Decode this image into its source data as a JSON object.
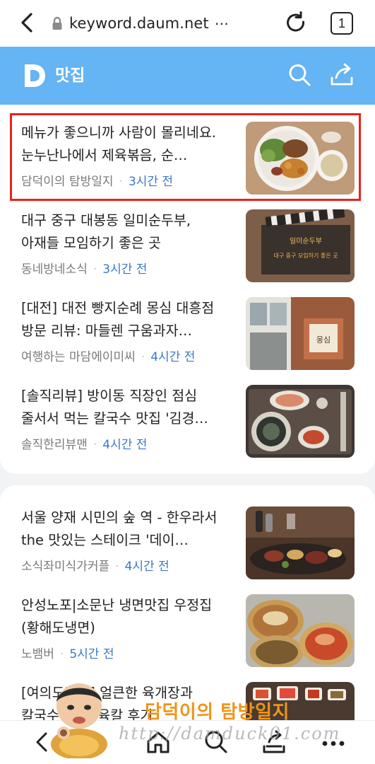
{
  "browser": {
    "url": "keyword.daum.net",
    "url_more": "⋯",
    "tab_count": "1",
    "icons": [
      "back-arrow",
      "lock",
      "reload",
      "tab-switcher"
    ]
  },
  "header": {
    "logo": "D",
    "title": "맛집",
    "accent_color": "#65b4f3",
    "icons": [
      "search",
      "share"
    ]
  },
  "results": [
    {
      "title": "메뉴가 좋으니까 사람이 몰리네요. 눈누난나에서 제육볶음, 순…",
      "source": "담덕이의 탐방일지",
      "time": "3시간 전",
      "thumbnail": "food-plate-salad",
      "highlighted": true
    },
    {
      "title": "대구 중구 대봉동 일미순두부, 아재들 모임하기 좋은 곳",
      "source": "동네방네소식",
      "time": "3시간 전",
      "thumbnail": "clapperboard-title",
      "thumb_text": [
        "일미순두부",
        "대구 중구 모임하기 좋은 곳"
      ]
    },
    {
      "title": "[대전] 대전 빵지순례 몽심 대흥점 방문 리뷰: 마들렌 구움과자…",
      "source": "여행하는 마담에이미씨",
      "time": "4시간 전",
      "thumbnail": "bakery-storefront",
      "thumb_text": [
        "몽심"
      ]
    },
    {
      "title": "[솔직리뷰] 방이동 직장인 점심 줄서서 먹는 칼국수 맛집 '김경…",
      "source": "솔직한리뷰맨",
      "time": "4시간 전",
      "thumbnail": "noodle-table"
    },
    {
      "title": "서울 양재 시민의 숲 역 - 한우라서 the 맛있는 스테이크 '데이…",
      "source": "소식좌미식가커플",
      "time": "4시간 전",
      "thumbnail": "steak-dinner"
    },
    {
      "title": "안성노포|소문난 냉면맛집 우정집(황해도냉면)",
      "source": "노뱀버",
      "time": "5시간 전",
      "thumbnail": "cold-noodles"
    },
    {
      "title": "[여의도맛집] 얼큰한 육개장과 칼국수 맛집, 육칼 후기",
      "source": "",
      "time": "",
      "thumbnail": "side-dishes"
    }
  ],
  "bottom_nav": {
    "icons": [
      "back",
      "forward",
      "home",
      "search",
      "tabs",
      "more"
    ]
  },
  "watermark": {
    "name": "담덕이의 탐방일지",
    "url": "http://damduck01.com"
  },
  "colors": {
    "highlight_border": "#e8231c",
    "time_text": "#3a78c8",
    "source_text": "#7a7a7a"
  }
}
